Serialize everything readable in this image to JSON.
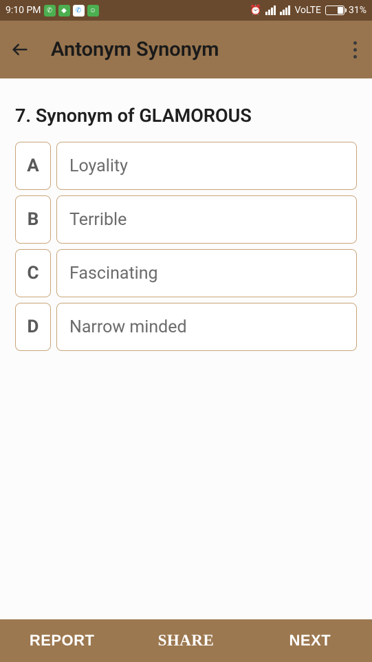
{
  "status": {
    "time": "9:10 PM",
    "network_label": "VoLTE",
    "battery_percent": "31%"
  },
  "appbar": {
    "title": "Antonym Synonym"
  },
  "question": {
    "number": "7.",
    "prompt": "Synonym of GLAMOROUS"
  },
  "options": [
    {
      "letter": "A",
      "text": "Loyality"
    },
    {
      "letter": "B",
      "text": "Terrible"
    },
    {
      "letter": "C",
      "text": "Fascinating"
    },
    {
      "letter": "D",
      "text": "Narrow minded"
    }
  ],
  "bottom": {
    "report": "REPORT",
    "share": "SHARE",
    "next": "NEXT"
  }
}
